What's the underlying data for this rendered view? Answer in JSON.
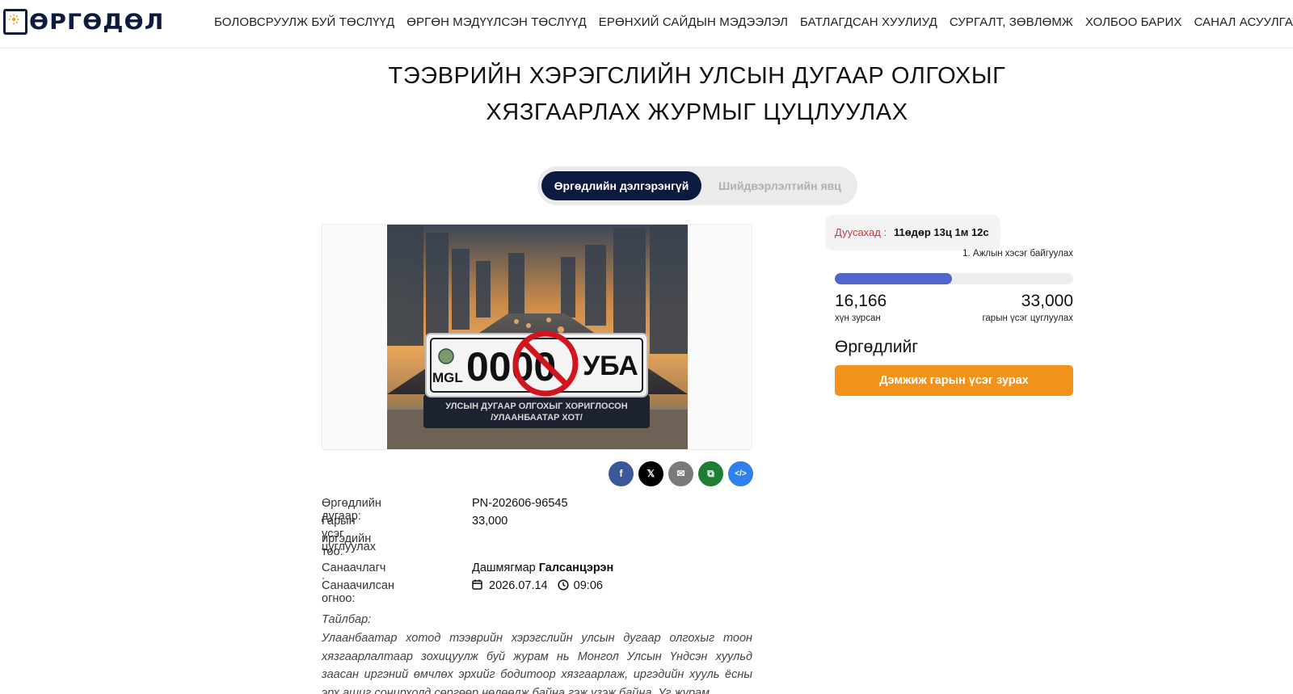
{
  "brand": {
    "logo_text": "ӨРГӨДӨЛ"
  },
  "nav": {
    "items": [
      "БОЛОВСРУУЛЖ БУЙ ТӨСЛҮҮД",
      "ӨРГӨН МЭДҮҮЛСЭН ТӨСЛҮҮД",
      "ЕРӨНХИЙ САЙДЫН МЭДЭЭЛЭЛ",
      "БАТЛАГДСАН ХУУЛИУД",
      "СУРГАЛТ, ЗӨВЛӨМЖ",
      "ХОЛБОО БАРИХ",
      "САНАЛ АСУУЛГА"
    ]
  },
  "page": {
    "title_line1": "ТЭЭВРИЙН ХЭРЭГСЛИЙН УЛСЫН ДУГААР ОЛГОХЫГ",
    "title_line2": "ХЯЗГААРЛАХ ЖУРМЫГ ЦУЦЛУУЛАХ"
  },
  "tabs": {
    "active": "Өргөдлийн дэлгэрэнгүй",
    "inactive": "Шийдвэрлэлтийн явц"
  },
  "photo": {
    "plate_region": "MGL",
    "plate_digits": "0000",
    "plate_letters": "УБА",
    "stand_line1": "УЛСЫН ДУГААР ОЛГОХЫГ ХОРИГЛОСОН",
    "stand_line2": "/УЛААНБААТАР ХОТ/"
  },
  "share": {
    "icons": [
      "facebook-icon",
      "x-icon",
      "email-icon",
      "copy-icon",
      "embed-icon"
    ],
    "colors": [
      "#3b5998",
      "#000000",
      "#7a7a7a",
      "#1e7e34",
      "#2f80ed"
    ],
    "glyphs": [
      "f",
      "𝕏",
      "✉",
      "⧉",
      "</>"
    ]
  },
  "details": {
    "number_label": "Өргөдлийн дугаар:",
    "number_value": "PN-202606-96545",
    "target_label_line1": "Гарын үсэг цуглуулах",
    "target_label_line2": "иргэдийн тоо:",
    "target_value": "33,000",
    "initiator_label": "Санаачлагч :",
    "initiator_first": "Дашмягмар",
    "initiator_last": "Галсанцэрэн",
    "date_label": "Санаачилсан огноо:",
    "date_value": "2026.07.14",
    "time_value": "09:06",
    "description_label": "Тайлбар:",
    "description": "Улаанбаатар хотод тээврийн хэрэгслийн улсын дугаар олгохыг тоон хязгаарлалтаар зохицуулж буй журам нь Монгол Улсын Үндсэн хуульд заасан иргэний өмчлөх эрхийг бодитоор хязгаарлаж, иргэдийн хууль ёсны эрх ашиг сонирхолд сөргөөр нөлөөлж байна гэж үзэж байна. Уг журам"
  },
  "sidebar": {
    "deadline_label": "Дуусахад :",
    "deadline_value": "11өдөр 13ц 1м 12с",
    "stage": "1. Ажлын хэсэг байгуулах",
    "signed_count": "16,166",
    "signed_label": "хүн зурсан",
    "target_count": "33,000",
    "target_label": "гарын үсэг цуглуулах",
    "progress_fraction": 0.49,
    "heading": "Өргөдлийг",
    "sign_button": "Дэмжиж гарын үсэг зурах",
    "accent_orange": "#f2921b",
    "progress_color": "#5066c9"
  }
}
